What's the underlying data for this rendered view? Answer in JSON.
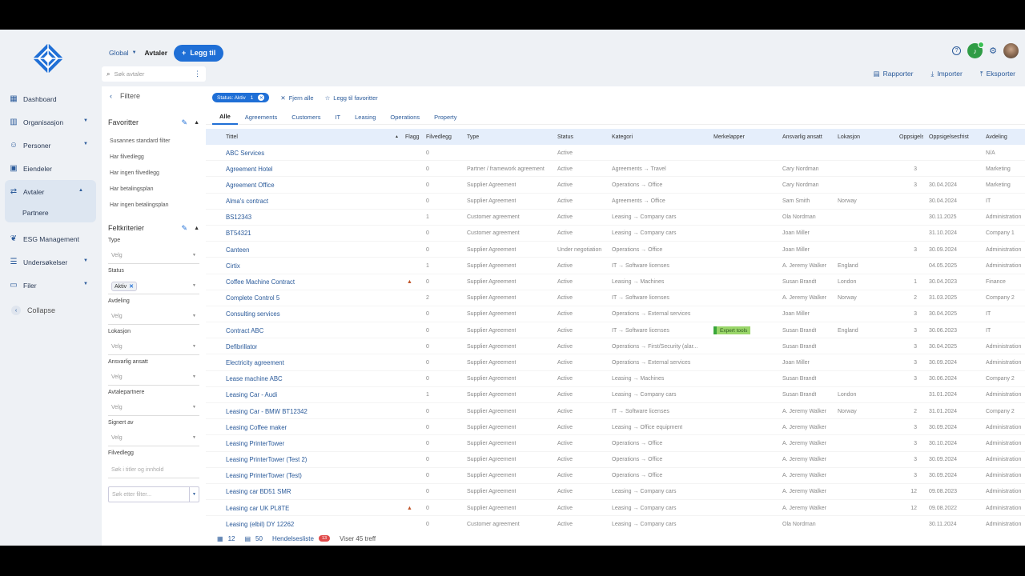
{
  "app": {
    "name": "Avtaler"
  },
  "colors": {
    "accent": "#1f6fd6",
    "link": "#2a5a9a",
    "tag": "#9ad66a"
  },
  "nav": [
    {
      "label": "Dashboard",
      "icon": "dashboard-icon",
      "chevron": false
    },
    {
      "label": "Organisasjon",
      "icon": "building-icon",
      "chevron": true
    },
    {
      "label": "Personer",
      "icon": "people-icon",
      "chevron": true
    },
    {
      "label": "Eiendeler",
      "icon": "assets-icon",
      "chevron": false
    },
    {
      "label": "Avtaler",
      "icon": "handshake-icon",
      "chevron": true,
      "active": true
    },
    {
      "label": "ESG Management",
      "icon": "leaf-icon",
      "chevron": false
    },
    {
      "label": "Undersøkelser",
      "icon": "survey-icon",
      "chevron": true
    },
    {
      "label": "Filer",
      "icon": "folder-icon",
      "chevron": true
    }
  ],
  "nav_sub": "Partnere",
  "collapse": "Collapse",
  "topbar": {
    "global": "Global",
    "current": "Avtaler",
    "add": "Legg til"
  },
  "search": {
    "placeholder": "Søk avtaler"
  },
  "actions": {
    "reports": "Rapporter",
    "import": "Importer",
    "export": "Eksporter"
  },
  "filters": {
    "title": "Filtere",
    "favorites_title": "Favoritter",
    "favorites": [
      "Susannes standard filter",
      "Har filvedlegg",
      "Har ingen filvedlegg",
      "Har betalingsplan",
      "Har ingen betalingsplan"
    ],
    "criteria_title": "Feltkriterier",
    "fields": [
      {
        "label": "Type",
        "value": "Velg"
      },
      {
        "label": "Status",
        "chip": "Aktiv"
      },
      {
        "label": "Avdeling",
        "value": "Velg"
      },
      {
        "label": "Lokasjon",
        "value": "Velg"
      },
      {
        "label": "Ansvarlig ansatt",
        "value": "Velg"
      },
      {
        "label": "Avtalepartnere",
        "value": "Velg"
      },
      {
        "label": "Signert av",
        "value": "Velg"
      }
    ],
    "filvedlegg_label": "Filvedlegg",
    "filvedlegg_placeholder": "Søk i titler og innhold",
    "more_placeholder": "Søk etter filter..."
  },
  "status_chip": "Status: Aktiv",
  "status_count": "1",
  "clear_all": "Fjern alle",
  "add_favorite": "Legg til favoritter",
  "tabs": [
    "Alle",
    "Agreements",
    "Customers",
    "IT",
    "Leasing",
    "Operations",
    "Property"
  ],
  "columns": [
    "Tittel",
    "Flagg",
    "Filvedlegg",
    "Type",
    "Status",
    "Kategori",
    "Merkelapper",
    "Ansvarlig ansatt",
    "Lokasjon",
    "Oppsigelsestid",
    "Oppsigelsesfrist",
    "Avdeling"
  ],
  "rows": [
    [
      "ABC Services",
      "",
      "0",
      "",
      "Active",
      "",
      "",
      "",
      "",
      "",
      "",
      "N/A"
    ],
    [
      "Agreement Hotel",
      "",
      "0",
      "Partner / framework agreement",
      "Active",
      "Agreements → Travel",
      "",
      "Cary Nordman",
      "",
      "3",
      "",
      "Marketing"
    ],
    [
      "Agreement Office",
      "",
      "0",
      "Supplier Agreement",
      "Active",
      "Operations → Office",
      "",
      "Cary Nordman",
      "",
      "3",
      "30.04.2024",
      "Marketing"
    ],
    [
      "Alma's contract",
      "",
      "0",
      "Supplier Agreement",
      "Active",
      "Agreements → Office",
      "",
      "Sam Smith",
      "Norway",
      "",
      "30.04.2024",
      "IT"
    ],
    [
      "BS12343",
      "",
      "1",
      "Customer agreement",
      "Active",
      "Leasing → Company cars",
      "",
      "Ola Nordman",
      "",
      "",
      "30.11.2025",
      "Administration"
    ],
    [
      "BT54321",
      "",
      "0",
      "Customer agreement",
      "Active",
      "Leasing → Company cars",
      "",
      "Joan Miller",
      "",
      "",
      "31.10.2024",
      "Company 1"
    ],
    [
      "Canteen",
      "",
      "0",
      "Supplier Agreement",
      "Under negotiation",
      "Operations → Office",
      "",
      "Joan Miller",
      "",
      "3",
      "30.09.2024",
      "Administration"
    ],
    [
      "Cirtix",
      "",
      "1",
      "Supplier Agreement",
      "Active",
      "IT → Software licenses",
      "",
      "A. Jeremy Walker",
      "England",
      "",
      "04.05.2025",
      "Administration"
    ],
    [
      "Coffee Machine Contract",
      "warn",
      "0",
      "Supplier Agreement",
      "Active",
      "Leasing → Machines",
      "",
      "Susan Brandt",
      "London",
      "1",
      "30.04.2023",
      "Finance"
    ],
    [
      "Complete Control 5",
      "",
      "2",
      "Supplier Agreement",
      "Active",
      "IT → Software licenses",
      "",
      "A. Jeremy Walker",
      "Norway",
      "2",
      "31.03.2025",
      "Company 2"
    ],
    [
      "Consulting services",
      "",
      "0",
      "Supplier Agreement",
      "Active",
      "Operations → External services",
      "",
      "Joan Miller",
      "",
      "3",
      "30.04.2025",
      "IT"
    ],
    [
      "Contract ABC",
      "",
      "0",
      "Supplier Agreement",
      "Active",
      "IT → Software licenses",
      "Expert tools",
      "Susan Brandt",
      "England",
      "3",
      "30.06.2023",
      "IT"
    ],
    [
      "Defibrillator",
      "",
      "0",
      "Supplier Agreement",
      "Active",
      "Operations → First/Security (alar...",
      "",
      "Susan Brandt",
      "",
      "3",
      "30.04.2025",
      "Administration"
    ],
    [
      "Electricity agreement",
      "",
      "0",
      "Supplier Agreement",
      "Active",
      "Operations → External services",
      "",
      "Joan Miller",
      "",
      "3",
      "30.09.2024",
      "Administration"
    ],
    [
      "Lease machine ABC",
      "",
      "0",
      "Supplier Agreement",
      "Active",
      "Leasing → Machines",
      "",
      "Susan Brandt",
      "",
      "3",
      "30.06.2024",
      "Company 2"
    ],
    [
      "Leasing Car - Audi",
      "",
      "1",
      "Supplier Agreement",
      "Active",
      "Leasing → Company cars",
      "",
      "Susan Brandt",
      "London",
      "",
      "31.01.2024",
      "Administration"
    ],
    [
      "Leasing Car - BMW BT12342",
      "",
      "0",
      "Supplier Agreement",
      "Active",
      "IT → Software licenses",
      "",
      "A. Jeremy Walker",
      "Norway",
      "2",
      "31.01.2024",
      "Company 2"
    ],
    [
      "Leasing Coffee maker",
      "",
      "0",
      "Supplier Agreement",
      "Active",
      "Leasing → Office equipment",
      "",
      "A. Jeremy Walker",
      "",
      "3",
      "30.09.2024",
      "Administration"
    ],
    [
      "Leasing PrinterTower",
      "",
      "0",
      "Supplier Agreement",
      "Active",
      "Operations → Office",
      "",
      "A. Jeremy Walker",
      "",
      "3",
      "30.10.2024",
      "Administration"
    ],
    [
      "Leasing PrinterTower (Test 2)",
      "",
      "0",
      "Supplier Agreement",
      "Active",
      "Operations → Office",
      "",
      "A. Jeremy Walker",
      "",
      "3",
      "30.09.2024",
      "Administration"
    ],
    [
      "Leasing PrinterTower (Test)",
      "",
      "0",
      "Supplier Agreement",
      "Active",
      "Operations → Office",
      "",
      "A. Jeremy Walker",
      "",
      "3",
      "30.09.2024",
      "Administration"
    ],
    [
      "Leasing car BD51 SMR",
      "",
      "0",
      "Supplier Agreement",
      "Active",
      "Leasing → Company cars",
      "",
      "A. Jeremy Walker",
      "",
      "12",
      "09.08.2023",
      "Administration"
    ],
    [
      "Leasing car UK PL8TE",
      "warn",
      "0",
      "Supplier Agreement",
      "Active",
      "Leasing → Company cars",
      "",
      "A. Jeremy Walker",
      "",
      "12",
      "09.08.2022",
      "Administration"
    ],
    [
      "Leasing (elbil) DY 12262",
      "",
      "0",
      "Customer agreement",
      "Active",
      "Leasing → Company cars",
      "",
      "Ola Nordman",
      "",
      "",
      "30.11.2024",
      "Administration"
    ]
  ],
  "footer": {
    "view1": "12",
    "view2": "50",
    "eventlist": "Hendelsesliste",
    "event_count": "13",
    "hits": "Viser 45 treff"
  }
}
